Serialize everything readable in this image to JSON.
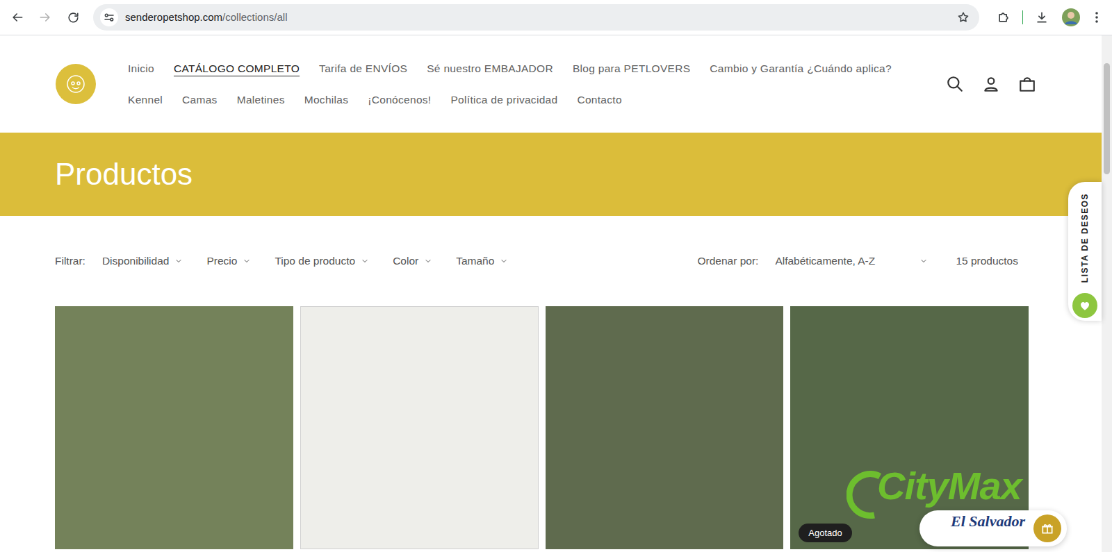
{
  "browser": {
    "back_disabled": false,
    "forward_disabled": true,
    "url_host": "senderopetshop.com",
    "url_path": "/collections/all"
  },
  "nav": {
    "row1": [
      {
        "label": "Inicio",
        "selected": false
      },
      {
        "label": "CATÁLOGO COMPLETO",
        "selected": true
      },
      {
        "label": "Tarifa de ENVÍOS",
        "selected": false
      },
      {
        "label": "Sé nuestro EMBAJADOR",
        "selected": false
      },
      {
        "label": "Blog para PETLOVERS",
        "selected": false
      },
      {
        "label": "Cambio y Garantía ¿Cuándo aplica?",
        "selected": false
      }
    ],
    "row2": [
      {
        "label": "Kennel",
        "selected": false
      },
      {
        "label": "Camas",
        "selected": false
      },
      {
        "label": "Maletines",
        "selected": false
      },
      {
        "label": "Mochilas",
        "selected": false
      },
      {
        "label": "¡Conócenos!",
        "selected": false
      },
      {
        "label": "Política de privacidad",
        "selected": false
      },
      {
        "label": "Contacto",
        "selected": false
      }
    ]
  },
  "banner": {
    "title": "Productos"
  },
  "filters": {
    "label": "Filtrar:",
    "items": [
      "Disponibilidad",
      "Precio",
      "Tipo de producto",
      "Color",
      "Tamaño"
    ],
    "sort_label": "Ordenar por:",
    "sort_value": "Alfabéticamente, A-Z",
    "count": "15 productos"
  },
  "products": [
    {
      "sold_out": false
    },
    {
      "sold_out": false
    },
    {
      "sold_out": false
    },
    {
      "sold_out": true,
      "badge": "Agotado"
    }
  ],
  "wishlist": {
    "label": "LISTA DE DESEOS"
  },
  "watermark": {
    "brand": "CityMax",
    "region": "El Salvador"
  }
}
